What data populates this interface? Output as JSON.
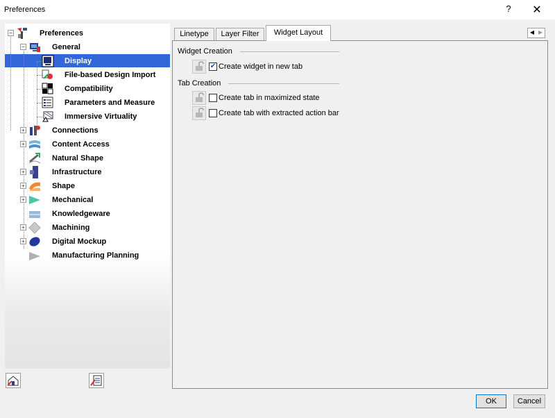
{
  "window": {
    "title": "Preferences",
    "help_glyph": "?",
    "close_glyph": "✕"
  },
  "tree": {
    "items": [
      {
        "label": "Preferences",
        "icon": "preferences-tools-icon",
        "expand": "−"
      },
      {
        "label": "General",
        "icon": "general-monitor-icon",
        "expand": "−"
      },
      {
        "label": "Display",
        "icon": "display-monitor-icon"
      },
      {
        "label": "File-based Design Import",
        "icon": "file-import-icon"
      },
      {
        "label": "Compatibility",
        "icon": "compatibility-icon"
      },
      {
        "label": "Parameters and Measure",
        "icon": "parameters-measure-icon"
      },
      {
        "label": "Immersive Virtuality",
        "icon": "immersive-virtuality-icon"
      },
      {
        "label": "Connections",
        "icon": "connections-icon",
        "expand": "+"
      },
      {
        "label": "Content Access",
        "icon": "content-access-icon",
        "expand": "+"
      },
      {
        "label": "Natural Shape",
        "icon": "natural-shape-icon"
      },
      {
        "label": "Infrastructure",
        "icon": "infrastructure-icon",
        "expand": "+"
      },
      {
        "label": "Shape",
        "icon": "shape-icon",
        "expand": "+"
      },
      {
        "label": "Mechanical",
        "icon": "mechanical-icon",
        "expand": "+"
      },
      {
        "label": "Knowledgeware",
        "icon": "knowledgeware-icon"
      },
      {
        "label": "Machining",
        "icon": "machining-icon",
        "expand": "+"
      },
      {
        "label": "Digital Mockup",
        "icon": "digital-mockup-icon",
        "expand": "+"
      },
      {
        "label": "Manufacturing Planning",
        "icon": "manufacturing-planning-icon"
      }
    ],
    "selected": "Display"
  },
  "tabs": [
    {
      "label": "Linetype"
    },
    {
      "label": "Layer Filter"
    },
    {
      "label": "Widget Layout",
      "active": true
    }
  ],
  "tab_scroll": {
    "left": "◀",
    "right": "▶"
  },
  "widget_creation": {
    "title": "Widget Creation",
    "options": [
      {
        "label": "Create widget in new tab",
        "checked": true
      }
    ]
  },
  "tab_creation": {
    "title": "Tab Creation",
    "options": [
      {
        "label": "Create tab in maximized state",
        "checked": false
      },
      {
        "label": "Create tab with extracted action bar",
        "checked": false
      }
    ]
  },
  "footer": {
    "ok_label": "OK",
    "cancel_label": "Cancel"
  },
  "colors": {
    "selection": "#3167d6",
    "ok_border": "#0078d7"
  }
}
